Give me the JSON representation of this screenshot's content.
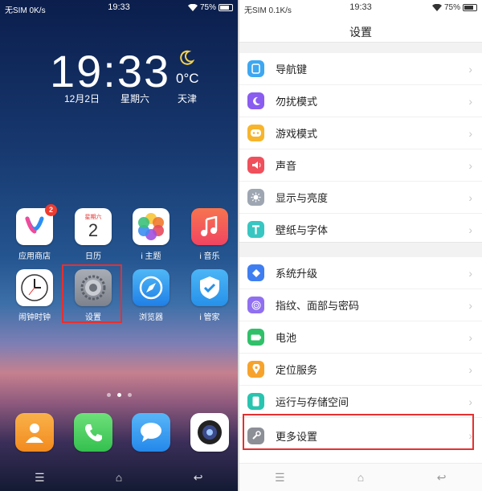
{
  "left": {
    "status": {
      "carrier": "无SIM 0K/s",
      "time": "19:33",
      "battery": "75%"
    },
    "widget": {
      "time": "19:33",
      "date": "12月2日",
      "weekday": "星期六",
      "temp": "0°C",
      "city": "天津"
    },
    "apps": [
      {
        "label": "应用商店",
        "icon": "app-store-icon",
        "badge": "2"
      },
      {
        "label": "日历",
        "icon": "calendar-icon",
        "calendar_weekday": "星期六",
        "calendar_day": "2"
      },
      {
        "label": "i 主题",
        "icon": "theme-icon"
      },
      {
        "label": "i 音乐",
        "icon": "music-icon"
      },
      {
        "label": "闹钟时钟",
        "icon": "clock-icon"
      },
      {
        "label": "设置",
        "icon": "settings-gear-icon"
      },
      {
        "label": "浏览器",
        "icon": "browser-icon"
      },
      {
        "label": "i 管家",
        "icon": "shield-icon"
      }
    ],
    "dock": [
      {
        "icon": "contacts-icon"
      },
      {
        "icon": "phone-icon"
      },
      {
        "icon": "messages-icon"
      },
      {
        "icon": "camera-icon"
      }
    ],
    "nav": {
      "menu": "☰",
      "home": "⌂",
      "back": "↩"
    }
  },
  "right": {
    "status": {
      "carrier": "无SIM 0.1K/s",
      "time": "19:33",
      "battery": "75%"
    },
    "title": "设置",
    "group1": [
      {
        "label": "导航键",
        "icon": "nav-keys-icon",
        "color": "#3ea7f0"
      },
      {
        "label": "勿扰模式",
        "icon": "moon-icon",
        "color": "#8a5cf0"
      },
      {
        "label": "游戏模式",
        "icon": "game-icon",
        "color": "#f7b52c"
      },
      {
        "label": "声音",
        "icon": "speaker-icon",
        "color": "#f0505b"
      },
      {
        "label": "显示与亮度",
        "icon": "brightness-icon",
        "color": "#9ea6b2"
      },
      {
        "label": "壁纸与字体",
        "icon": "font-icon",
        "color": "#38c6c2"
      }
    ],
    "group2": [
      {
        "label": "系统升级",
        "icon": "system-update-icon",
        "color": "#3f7ef0"
      },
      {
        "label": "指纹、面部与密码",
        "icon": "fingerprint-icon",
        "color": "#9070f0"
      },
      {
        "label": "电池",
        "icon": "battery-icon",
        "color": "#30c06a"
      },
      {
        "label": "定位服务",
        "icon": "location-icon",
        "color": "#f7a32b"
      },
      {
        "label": "运行与存储空间",
        "icon": "storage-icon",
        "color": "#28c4b0"
      },
      {
        "label": "更多设置",
        "icon": "wrench-icon",
        "color": "#8c8f96"
      }
    ],
    "nav": {
      "menu": "☰",
      "home": "⌂",
      "back": "↩"
    }
  },
  "colors": {
    "highlight": "#e53030"
  }
}
